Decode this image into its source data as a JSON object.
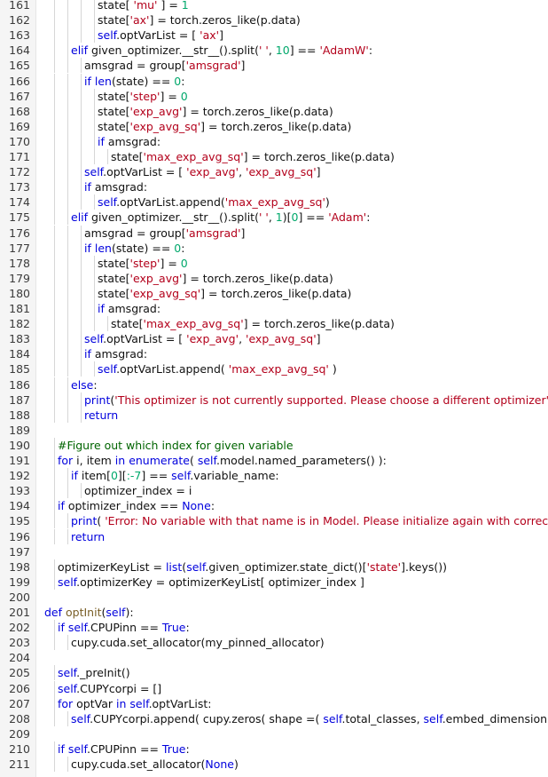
{
  "editor": {
    "lines": [
      {
        "n": "161",
        "i": 5,
        "t": [
          [
            "",
            "state[ "
          ],
          [
            "str",
            "'mu'"
          ],
          [
            "",
            " ] = "
          ],
          [
            "num",
            "1"
          ]
        ]
      },
      {
        "n": "162",
        "i": 5,
        "t": [
          [
            "",
            "state["
          ],
          [
            "str",
            "'ax'"
          ],
          [
            "",
            "] = torch.zeros_like(p.data)"
          ]
        ]
      },
      {
        "n": "163",
        "i": 5,
        "t": [
          [
            "kw",
            "self"
          ],
          [
            "",
            ".optVarList = [ "
          ],
          [
            "str",
            "'ax'"
          ],
          [
            "",
            "]"
          ]
        ]
      },
      {
        "n": "164",
        "i": 3,
        "t": [
          [
            "kw",
            "elif"
          ],
          [
            "",
            " given_optimizer.__str__().split("
          ],
          [
            "str",
            "' '"
          ],
          [
            "",
            ", "
          ],
          [
            "num",
            "1"
          ],
          [
            ")["
          ],
          [
            "num",
            "0"
          ],
          [
            "",
            "] == "
          ],
          [
            "str",
            "'AdamW'"
          ],
          [
            "",
            ":"
          ]
        ]
      },
      {
        "n": "165",
        "i": 4,
        "t": [
          [
            "",
            "amsgrad = group["
          ],
          [
            "str",
            "'amsgrad'"
          ],
          [
            "",
            "]"
          ]
        ]
      },
      {
        "n": "166",
        "i": 4,
        "t": [
          [
            "kw",
            "if"
          ],
          [
            "",
            " "
          ],
          [
            "bi",
            "len"
          ],
          [
            "",
            "(state) == "
          ],
          [
            "num",
            "0"
          ],
          [
            "",
            ":"
          ]
        ]
      },
      {
        "n": "167",
        "i": 5,
        "t": [
          [
            "",
            "state["
          ],
          [
            "str",
            "'step'"
          ],
          [
            "",
            "] = "
          ],
          [
            "num",
            "0"
          ]
        ]
      },
      {
        "n": "168",
        "i": 5,
        "t": [
          [
            "",
            "state["
          ],
          [
            "str",
            "'exp_avg'"
          ],
          [
            "",
            "] = torch.zeros_like(p.data)"
          ]
        ]
      },
      {
        "n": "169",
        "i": 5,
        "t": [
          [
            "",
            "state["
          ],
          [
            "str",
            "'exp_avg_sq'"
          ],
          [
            "",
            "] = torch.zeros_like(p.data)"
          ]
        ]
      },
      {
        "n": "170",
        "i": 5,
        "t": [
          [
            "kw",
            "if"
          ],
          [
            "",
            " amsgrad:"
          ]
        ]
      },
      {
        "n": "171",
        "i": 6,
        "t": [
          [
            "",
            "state["
          ],
          [
            "str",
            "'max_exp_avg_sq'"
          ],
          [
            "",
            "] = torch.zeros_like(p.data)"
          ]
        ]
      },
      {
        "n": "172",
        "i": 4,
        "t": [
          [
            "kw",
            "self"
          ],
          [
            "",
            ".optVarList = [ "
          ],
          [
            "str",
            "'exp_avg'"
          ],
          [
            "",
            ", "
          ],
          [
            "str",
            "'exp_avg_sq'"
          ],
          [
            "",
            "]"
          ]
        ]
      },
      {
        "n": "173",
        "i": 4,
        "t": [
          [
            "kw",
            "if"
          ],
          [
            "",
            " amsgrad:"
          ]
        ]
      },
      {
        "n": "174",
        "i": 5,
        "t": [
          [
            "kw",
            "self"
          ],
          [
            "",
            ".optVarList.append("
          ],
          [
            "str",
            "'max_exp_avg_sq'"
          ],
          [
            "",
            ")"
          ]
        ]
      },
      {
        "n": "175",
        "i": 3,
        "t": [
          [
            "kw",
            "elif"
          ],
          [
            "",
            " given_optimizer.__str__().split("
          ],
          [
            "str",
            "' '"
          ],
          [
            "",
            ", "
          ],
          [
            "num",
            "1"
          ],
          [
            "",
            ")["
          ],
          [
            "num",
            "0"
          ],
          [
            "",
            "] == "
          ],
          [
            "str",
            "'Adam'"
          ],
          [
            "",
            ":"
          ]
        ]
      },
      {
        "n": "176",
        "i": 4,
        "t": [
          [
            "",
            "amsgrad = group["
          ],
          [
            "str",
            "'amsgrad'"
          ],
          [
            "",
            "]"
          ]
        ]
      },
      {
        "n": "177",
        "i": 4,
        "t": [
          [
            "kw",
            "if"
          ],
          [
            "",
            " "
          ],
          [
            "bi",
            "len"
          ],
          [
            "",
            "(state) == "
          ],
          [
            "num",
            "0"
          ],
          [
            "",
            ":"
          ]
        ]
      },
      {
        "n": "178",
        "i": 5,
        "t": [
          [
            "",
            "state["
          ],
          [
            "str",
            "'step'"
          ],
          [
            "",
            "] = "
          ],
          [
            "num",
            "0"
          ]
        ]
      },
      {
        "n": "179",
        "i": 5,
        "t": [
          [
            "",
            "state["
          ],
          [
            "str",
            "'exp_avg'"
          ],
          [
            "",
            "] = torch.zeros_like(p.data)"
          ]
        ]
      },
      {
        "n": "180",
        "i": 5,
        "t": [
          [
            "",
            "state["
          ],
          [
            "str",
            "'exp_avg_sq'"
          ],
          [
            "",
            "] = torch.zeros_like(p.data)"
          ]
        ]
      },
      {
        "n": "181",
        "i": 5,
        "t": [
          [
            "kw",
            "if"
          ],
          [
            "",
            " amsgrad:"
          ]
        ]
      },
      {
        "n": "182",
        "i": 6,
        "t": [
          [
            "",
            "state["
          ],
          [
            "str",
            "'max_exp_avg_sq'"
          ],
          [
            "",
            "] = torch.zeros_like(p.data)"
          ]
        ]
      },
      {
        "n": "183",
        "i": 4,
        "t": [
          [
            "kw",
            "self"
          ],
          [
            "",
            ".optVarList = [ "
          ],
          [
            "str",
            "'exp_avg'"
          ],
          [
            "",
            ", "
          ],
          [
            "str",
            "'exp_avg_sq'"
          ],
          [
            "",
            "]"
          ]
        ]
      },
      {
        "n": "184",
        "i": 4,
        "t": [
          [
            "kw",
            "if"
          ],
          [
            "",
            " amsgrad:"
          ]
        ]
      },
      {
        "n": "185",
        "i": 5,
        "t": [
          [
            "kw",
            "self"
          ],
          [
            "",
            ".optVarList.append( "
          ],
          [
            "str",
            "'max_exp_avg_sq'"
          ],
          [
            "",
            " )"
          ]
        ]
      },
      {
        "n": "186",
        "i": 3,
        "t": [
          [
            "kw",
            "else"
          ],
          [
            "",
            ":"
          ]
        ]
      },
      {
        "n": "187",
        "i": 4,
        "t": [
          [
            "bi",
            "print"
          ],
          [
            "",
            "("
          ],
          [
            "str",
            "'This optimizer is not currently supported. Please choose a different optimizer'"
          ],
          [
            "",
            ")"
          ]
        ]
      },
      {
        "n": "188",
        "i": 4,
        "t": [
          [
            "kw",
            "return"
          ]
        ]
      },
      {
        "n": "189",
        "i": 0,
        "t": []
      },
      {
        "n": "190",
        "i": 2,
        "t": [
          [
            "cm",
            "#Figure out which index for given variable"
          ]
        ]
      },
      {
        "n": "191",
        "i": 2,
        "t": [
          [
            "kw",
            "for"
          ],
          [
            "",
            " i, item "
          ],
          [
            "kw",
            "in"
          ],
          [
            "",
            " "
          ],
          [
            "bi",
            "enumerate"
          ],
          [
            "",
            "( "
          ],
          [
            "kw",
            "self"
          ],
          [
            "",
            ".model.named_parameters() ):"
          ]
        ]
      },
      {
        "n": "192",
        "i": 3,
        "t": [
          [
            "kw",
            "if"
          ],
          [
            "",
            " item["
          ],
          [
            "num",
            "0"
          ],
          [
            "",
            "]["
          ],
          [
            "num",
            ":-7"
          ],
          [
            "",
            "] == "
          ],
          [
            "kw",
            "self"
          ],
          [
            "",
            ".variable_name:"
          ]
        ]
      },
      {
        "n": "193",
        "i": 4,
        "t": [
          [
            "",
            "optimizer_index = i"
          ]
        ]
      },
      {
        "n": "194",
        "i": 2,
        "t": [
          [
            "kw",
            "if"
          ],
          [
            "",
            " optimizer_index == "
          ],
          [
            "kw",
            "None"
          ],
          [
            "",
            ":"
          ]
        ]
      },
      {
        "n": "195",
        "i": 3,
        "t": [
          [
            "bi",
            "print"
          ],
          [
            "",
            "( "
          ],
          [
            "str",
            "'Error: No variable with that name is in Model. Please initialize again with correct name'"
          ],
          [
            "",
            ")"
          ]
        ]
      },
      {
        "n": "196",
        "i": 3,
        "t": [
          [
            "kw",
            "return"
          ]
        ]
      },
      {
        "n": "197",
        "i": 0,
        "t": []
      },
      {
        "n": "198",
        "i": 2,
        "t": [
          [
            "",
            "optimizerKeyList = "
          ],
          [
            "bi",
            "list"
          ],
          [
            "",
            "("
          ],
          [
            "kw",
            "self"
          ],
          [
            "",
            ".given_optimizer.state_dict()["
          ],
          [
            "str",
            "'state'"
          ],
          [
            "",
            "].keys())"
          ]
        ]
      },
      {
        "n": "199",
        "i": 2,
        "t": [
          [
            "kw",
            "self"
          ],
          [
            "",
            ".optimizerKey = optimizerKeyList[ optimizer_index ]"
          ]
        ]
      },
      {
        "n": "200",
        "i": 0,
        "t": []
      },
      {
        "n": "201",
        "i": 1,
        "t": [
          [
            "kw",
            "def"
          ],
          [
            "",
            " "
          ],
          [
            "fn",
            "optInit"
          ],
          [
            "",
            "("
          ],
          [
            "kw",
            "self"
          ],
          [
            "",
            "):"
          ]
        ]
      },
      {
        "n": "202",
        "i": 2,
        "t": [
          [
            "kw",
            "if"
          ],
          [
            "",
            " "
          ],
          [
            "kw",
            "self"
          ],
          [
            "",
            ".CPUPinn == "
          ],
          [
            "kw",
            "True"
          ],
          [
            "",
            ":"
          ]
        ]
      },
      {
        "n": "203",
        "i": 3,
        "t": [
          [
            "",
            "cupy.cuda.set_allocator(my_pinned_allocator)"
          ]
        ]
      },
      {
        "n": "204",
        "i": 0,
        "t": []
      },
      {
        "n": "205",
        "i": 2,
        "t": [
          [
            "kw",
            "self"
          ],
          [
            "",
            "._preInit()"
          ]
        ]
      },
      {
        "n": "206",
        "i": 2,
        "t": [
          [
            "kw",
            "self"
          ],
          [
            "",
            ".CUPYcorpi = []"
          ]
        ]
      },
      {
        "n": "207",
        "i": 2,
        "t": [
          [
            "kw",
            "for"
          ],
          [
            "",
            " optVar "
          ],
          [
            "kw",
            "in"
          ],
          [
            "",
            " "
          ],
          [
            "kw",
            "self"
          ],
          [
            "",
            ".optVarList:"
          ]
        ]
      },
      {
        "n": "208",
        "i": 3,
        "t": [
          [
            "kw",
            "self"
          ],
          [
            "",
            ".CUPYcorpi.append( cupy.zeros( shape =( "
          ],
          [
            "kw",
            "self"
          ],
          [
            "",
            ".total_classes, "
          ],
          [
            "kw",
            "self"
          ],
          [
            "",
            ".embed_dimension), dtype"
          ]
        ]
      },
      {
        "n": "209",
        "i": 0,
        "t": []
      },
      {
        "n": "210",
        "i": 2,
        "t": [
          [
            "kw",
            "if"
          ],
          [
            "",
            " "
          ],
          [
            "kw",
            "self"
          ],
          [
            "",
            ".CPUPinn == "
          ],
          [
            "kw",
            "True"
          ],
          [
            "",
            ":"
          ]
        ]
      },
      {
        "n": "211",
        "i": 3,
        "t": [
          [
            "",
            "cupy.cuda.set_allocator("
          ],
          [
            "kw",
            "None"
          ],
          [
            "",
            ")"
          ]
        ]
      }
    ]
  }
}
